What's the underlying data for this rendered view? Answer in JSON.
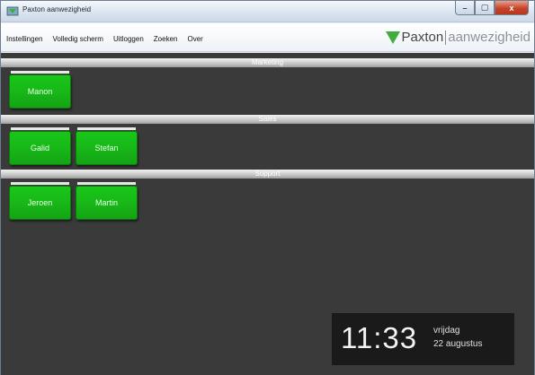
{
  "window": {
    "title": "Paxton aanwezigheid",
    "buttons": [
      "–",
      "▢",
      "x"
    ]
  },
  "menu": {
    "items": [
      "Instellingen",
      "Volledig scherm",
      "Uitloggen",
      "Zoeken",
      "Over"
    ]
  },
  "logo": {
    "brand": "Paxton",
    "product": "aanwezigheid"
  },
  "groups": [
    {
      "name": "Marketing",
      "people": [
        "Manon"
      ]
    },
    {
      "name": "Sales",
      "people": [
        "Galid",
        "Stefan"
      ]
    },
    {
      "name": "Support",
      "people": [
        "Jeroen",
        "Martin"
      ]
    }
  ],
  "clock": {
    "time": "11:33",
    "day": "vrijdag",
    "date": "22 augustus"
  },
  "colors": {
    "present": "#18b818",
    "background": "#3a3a3a",
    "logo_green": "#3fae3a"
  }
}
